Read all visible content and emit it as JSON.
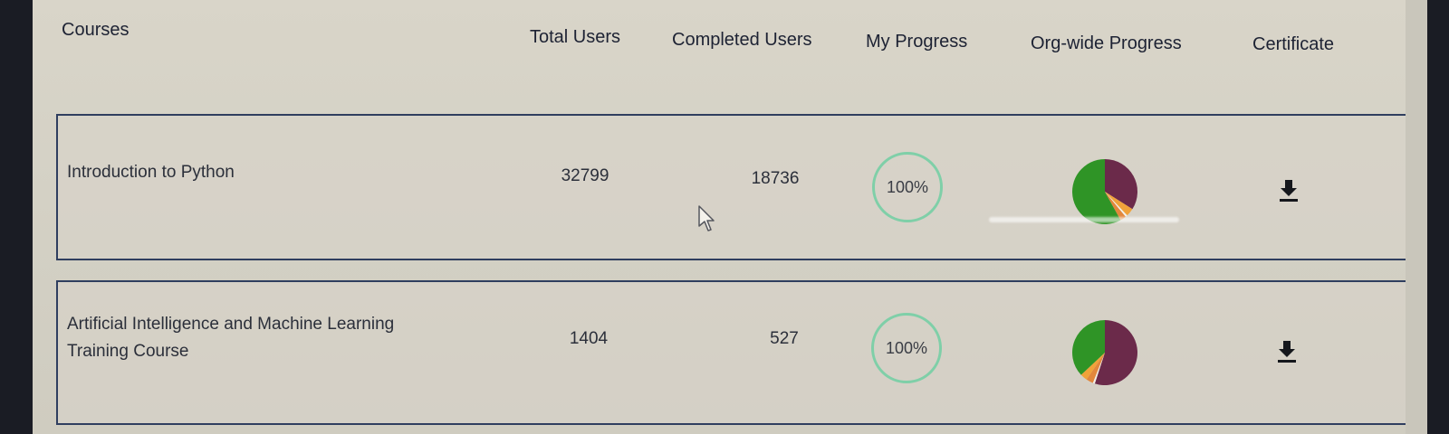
{
  "headers": {
    "courses": "Courses",
    "total_users": "Total Users",
    "completed_users": "Completed Users",
    "my_progress": "My Progress",
    "org_progress": "Org-wide Progress",
    "certificate": "Certificate"
  },
  "rows": [
    {
      "course_line1": "Introduction to Python",
      "course_line2": "",
      "total_users": "32799",
      "completed_users": "18736",
      "my_progress": "100%",
      "my_progress_value": 1.0,
      "org_progress_slices": [
        {
          "color": "#6b2a4a",
          "fraction": 0.34
        },
        {
          "color": "#f0a23a",
          "fraction": 0.04
        },
        {
          "color": "#f4f1e8",
          "fraction": 0.01
        },
        {
          "color": "#e2873c",
          "fraction": 0.03
        },
        {
          "color": "#2f9426",
          "fraction": 0.58
        }
      ],
      "certificate_icon": "download-icon"
    },
    {
      "course_line1": "Artificial Intelligence and Machine Learning",
      "course_line2": "Training Course",
      "total_users": "1404",
      "completed_users": "527",
      "my_progress": "100%",
      "my_progress_value": 1.0,
      "org_progress_slices": [
        {
          "color": "#6b2a4a",
          "fraction": 0.55
        },
        {
          "color": "#f4f1e8",
          "fraction": 0.01
        },
        {
          "color": "#e2873c",
          "fraction": 0.035
        },
        {
          "color": "#f0a23a",
          "fraction": 0.035
        },
        {
          "color": "#2f9426",
          "fraction": 0.37
        }
      ],
      "certificate_icon": "download-icon"
    }
  ],
  "colors": {
    "ring": "#7fcfa8",
    "card_border": "#2f3e5f",
    "download_icon": "#15171c"
  }
}
